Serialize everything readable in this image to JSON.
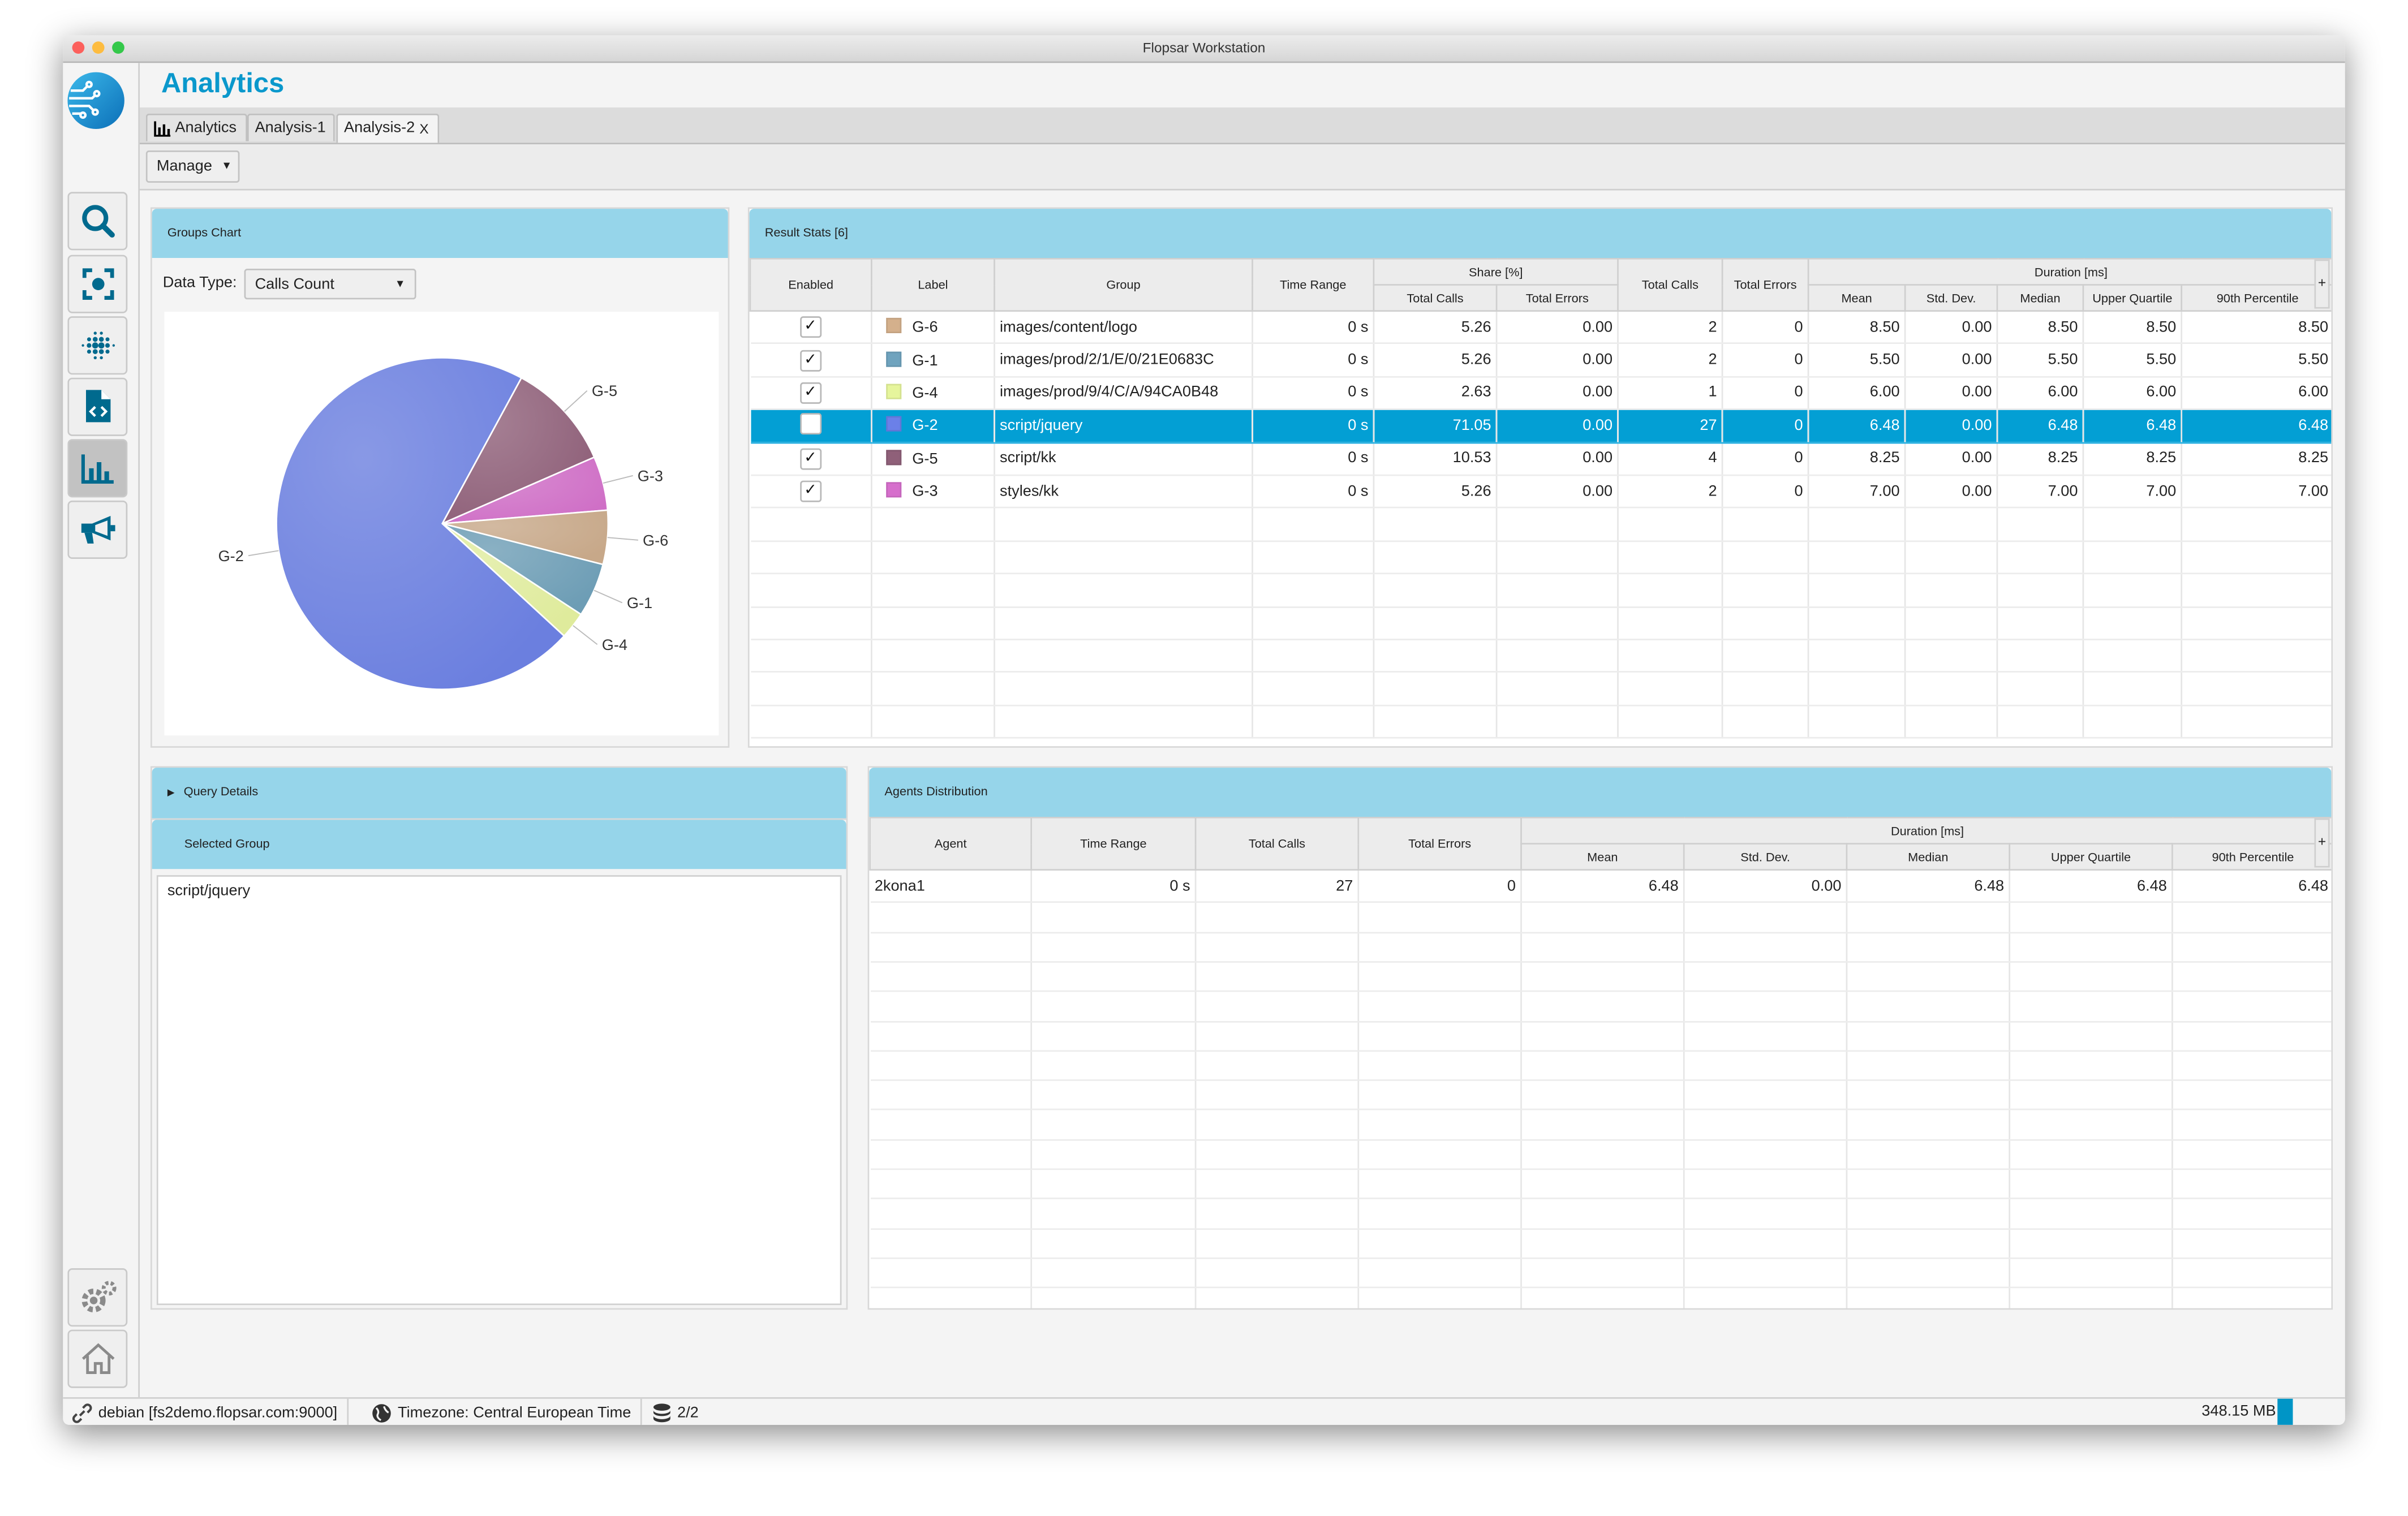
{
  "window": {
    "title": "Flopsar Workstation"
  },
  "app": {
    "title": "Analytics",
    "icon_color": "#006a8e",
    "accent": "#0a98cc"
  },
  "sidebar": {
    "items": [
      {
        "icon": "search-icon",
        "active": false
      },
      {
        "icon": "focus-icon",
        "active": false
      },
      {
        "icon": "dots-grid-icon",
        "active": false
      },
      {
        "icon": "code-file-icon",
        "active": false
      },
      {
        "icon": "bar-chart-icon",
        "active": true
      },
      {
        "icon": "megaphone-icon",
        "active": false
      }
    ],
    "bottom": [
      {
        "icon": "gears-icon"
      },
      {
        "icon": "home-icon"
      }
    ]
  },
  "tabs": [
    {
      "label": "Analytics",
      "icon": "bar-chart-icon",
      "selected": false
    },
    {
      "label": "Analysis-1",
      "selected": false
    },
    {
      "label": "Analysis-2",
      "selected": true,
      "closable": true,
      "close": "X"
    }
  ],
  "toolbar": {
    "manage_label": "Manage"
  },
  "groups_chart": {
    "title": "Groups Chart",
    "data_type_label": "Data Type:",
    "data_type_value": "Calls Count"
  },
  "chart_data": {
    "type": "pie",
    "slices": [
      {
        "label": "G-5",
        "value": 10.53,
        "color": "#8f6079"
      },
      {
        "label": "G-3",
        "value": 5.26,
        "color": "#cf6fc6"
      },
      {
        "label": "G-6",
        "value": 5.26,
        "color": "#c7a889"
      },
      {
        "label": "G-1",
        "value": 5.26,
        "color": "#6d9db5"
      },
      {
        "label": "G-4",
        "value": 2.63,
        "color": "#dfeb9c"
      },
      {
        "label": "G-2",
        "value": 71.05,
        "color": "#6b7fdf"
      }
    ]
  },
  "result_stats": {
    "title": "Result Stats [6]",
    "group_headers": {
      "share": "Share [%]",
      "duration": "Duration [ms]"
    },
    "columns": [
      "Enabled",
      "Label",
      "Group",
      "Time Range",
      "Total Calls",
      "Total Errors",
      "Total Calls",
      "Total Errors",
      "Mean",
      "Std. Dev.",
      "Median",
      "Upper Quartile",
      "90th Percentile"
    ],
    "column_menu": "+",
    "rows": [
      {
        "enabled": true,
        "label": "G-6",
        "color": "#d4b08c",
        "group": "images/content/logo",
        "time_range": "0 s",
        "share_calls": "5.26",
        "share_errors": "0.00",
        "calls": "2",
        "errors": "0",
        "mean": "8.50",
        "std": "0.00",
        "median": "8.50",
        "uq": "8.50",
        "p90": "8.50"
      },
      {
        "enabled": true,
        "label": "G-1",
        "color": "#6fa3be",
        "group": "images/prod/2/1/E/0/21E0683C",
        "time_range": "0 s",
        "share_calls": "5.26",
        "share_errors": "0.00",
        "calls": "2",
        "errors": "0",
        "mean": "5.50",
        "std": "0.00",
        "median": "5.50",
        "uq": "5.50",
        "p90": "5.50"
      },
      {
        "enabled": true,
        "label": "G-4",
        "color": "#e6f59c",
        "group": "images/prod/9/4/C/A/94CA0B48",
        "time_range": "0 s",
        "share_calls": "2.63",
        "share_errors": "0.00",
        "calls": "1",
        "errors": "0",
        "mean": "6.00",
        "std": "0.00",
        "median": "6.00",
        "uq": "6.00",
        "p90": "6.00"
      },
      {
        "enabled": false,
        "selected": true,
        "label": "G-2",
        "color": "#6b80e8",
        "group": "script/jquery",
        "time_range": "0 s",
        "share_calls": "71.05",
        "share_errors": "0.00",
        "calls": "27",
        "errors": "0",
        "mean": "6.48",
        "std": "0.00",
        "median": "6.48",
        "uq": "6.48",
        "p90": "6.48"
      },
      {
        "enabled": true,
        "label": "G-5",
        "color": "#8f6079",
        "group": "script/kk",
        "time_range": "0 s",
        "share_calls": "10.53",
        "share_errors": "0.00",
        "calls": "4",
        "errors": "0",
        "mean": "8.25",
        "std": "0.00",
        "median": "8.25",
        "uq": "8.25",
        "p90": "8.25"
      },
      {
        "enabled": true,
        "label": "G-3",
        "color": "#d66fcc",
        "group": "styles/kk",
        "time_range": "0 s",
        "share_calls": "5.26",
        "share_errors": "0.00",
        "calls": "2",
        "errors": "0",
        "mean": "7.00",
        "std": "0.00",
        "median": "7.00",
        "uq": "7.00",
        "p90": "7.00"
      }
    ],
    "selected_color": "#039fd4"
  },
  "query_details": {
    "title": "Query Details"
  },
  "selected_group": {
    "title": "Selected Group",
    "value": "script/jquery"
  },
  "agents": {
    "title": "Agents Distribution",
    "group_headers": {
      "duration": "Duration [ms]"
    },
    "columns": [
      "Agent",
      "Time Range",
      "Total Calls",
      "Total Errors",
      "Mean",
      "Std. Dev.",
      "Median",
      "Upper Quartile",
      "90th Percentile"
    ],
    "column_menu": "+",
    "rows": [
      {
        "agent": "2kona1",
        "time_range": "0 s",
        "calls": "27",
        "errors": "0",
        "mean": "6.48",
        "std": "0.00",
        "median": "6.48",
        "uq": "6.48",
        "p90": "6.48"
      }
    ]
  },
  "statusbar": {
    "connection": "debian [fs2demo.flopsar.com:9000]",
    "timezone": "Timezone: Central European Time",
    "databases": "2/2",
    "memory": "348.15 MB",
    "memory_fill_percent": 22
  }
}
